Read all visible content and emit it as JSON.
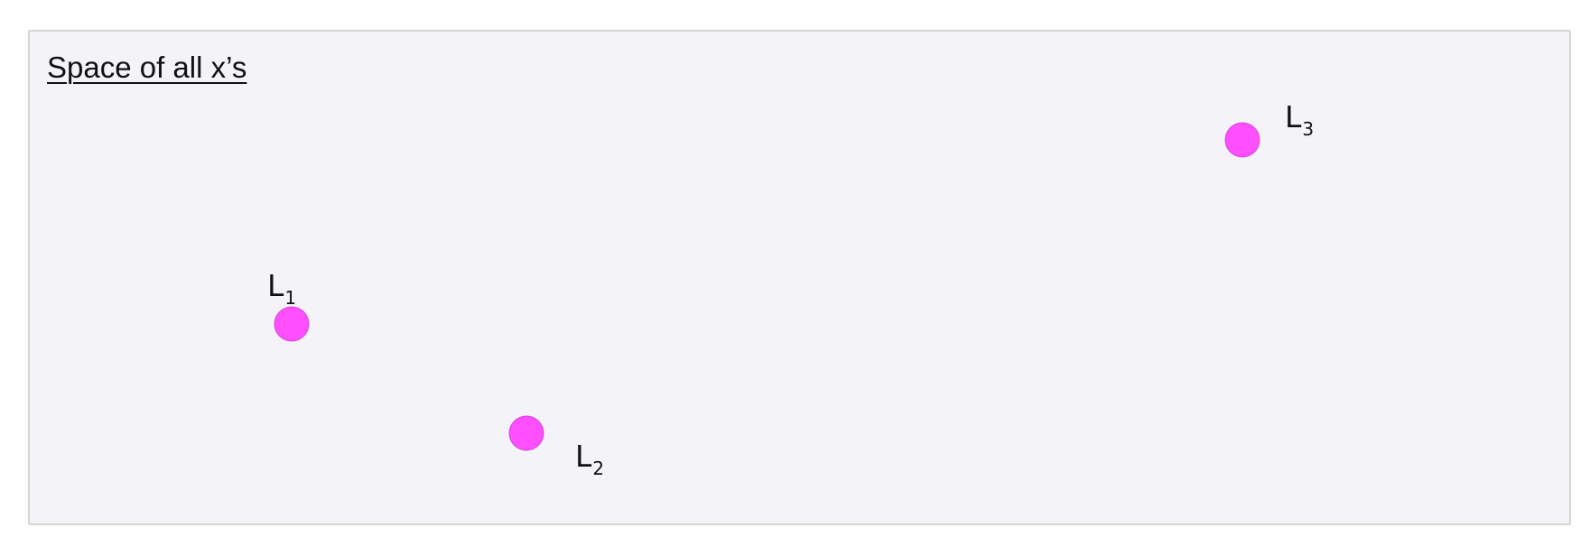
{
  "diagram": {
    "title": "Space of all x’s",
    "point_color": "#ff4fff",
    "points": [
      {
        "letter": "L",
        "subscript": "1"
      },
      {
        "letter": "L",
        "subscript": "2"
      },
      {
        "letter": "L",
        "subscript": "3"
      }
    ]
  }
}
